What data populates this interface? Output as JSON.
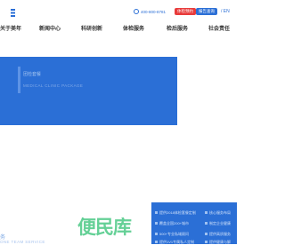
{
  "header": {
    "hotline": "400-800-8781",
    "btn_red": "体检预约",
    "btn_blue": "报告查询",
    "lang": "/ EN"
  },
  "nav": [
    "关于美年",
    "新闻中心",
    "科研创新",
    "体检服务",
    "检后服务",
    "社会责任"
  ],
  "hero": {
    "title": "团检套餐",
    "subtitle": "MEDICAL CLINIC PACKAGE"
  },
  "section": {
    "title": "务",
    "subtitle": "ONE TEAM SERVICE"
  },
  "panel_items": [
    "提供2018体检套餐定制",
    "核心服务布局",
    "覆盖全国200+城市",
    "制定企业健康",
    "500+专业私域顾问",
    "提供高质服务",
    "提供1V1专属私人定制",
    "提供健康与解"
  ],
  "watermark": "便民库",
  "colors": {
    "primary": "#2b6fd6",
    "accent_red": "#e83b3b"
  }
}
